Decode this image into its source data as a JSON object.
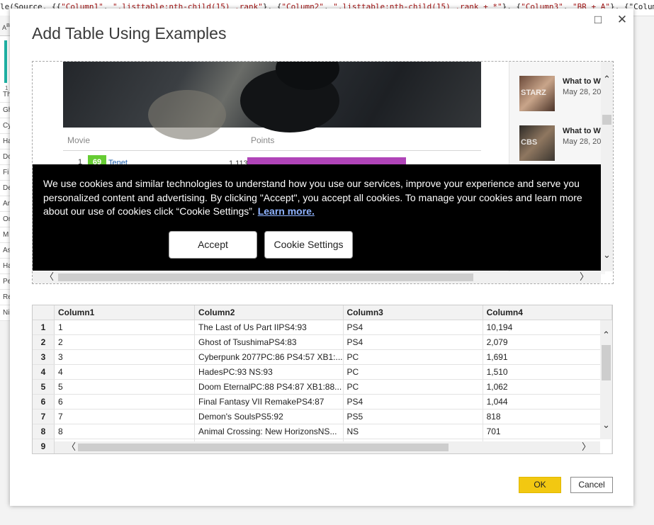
{
  "formula_bar": {
    "text": "le(Source, {{\"Column1\", \".listtable:nth-child(15) .rank\"}, {\"Column2\", \".listtable:nth-child(15) .rank + *\"}, {\"Column3\", \"BR + A\"}, {\"Colum"
  },
  "left_strip": {
    "header": "A",
    "header_sup": "B",
    "label": "1",
    "cells": [
      "Th",
      "Gh",
      "Cy",
      "Ha",
      "Do",
      "Fi",
      "De",
      "An",
      "Or",
      "M",
      "As",
      "Ha",
      "Pe",
      "Re",
      "Ni"
    ]
  },
  "dialog": {
    "title": "Add Table Using Examples",
    "restore_icon": "□",
    "close_icon": "✕",
    "ok_label": "OK",
    "cancel_label": "Cancel"
  },
  "preview": {
    "movie_chart": {
      "col_movie": "Movie",
      "col_points": "Points",
      "row": {
        "rank": "1",
        "score": "69",
        "name": "Tenet",
        "points": "1,113"
      }
    },
    "sidebar": [
      {
        "heading": "What to W",
        "date": "May 28, 20",
        "tag": "STARZ"
      },
      {
        "heading": "What to W",
        "date": "May 28, 20",
        "tag": "CBS"
      }
    ],
    "cookie": {
      "text": "We use cookies and similar technologies to understand how you use our services, improve your experience and serve you personalized content and advertising. By clicking \"Accept\", you accept all cookies. To manage your cookies and learn more about our use of cookies click “Cookie Settings”.",
      "link": "Learn more.",
      "accept": "Accept",
      "settings": "Cookie Settings"
    }
  },
  "table": {
    "columns": [
      "Column1",
      "Column2",
      "Column3",
      "Column4"
    ],
    "rows": [
      [
        "1",
        "1",
        "The Last of Us Part IIPS4:93",
        "PS4",
        "10,194"
      ],
      [
        "2",
        "2",
        "Ghost of TsushimaPS4:83",
        "PS4",
        "2,079"
      ],
      [
        "3",
        "3",
        "Cyberpunk 2077PC:86 PS4:57 XB1:...",
        "PC",
        "1,691"
      ],
      [
        "4",
        "4",
        "HadesPC:93 NS:93",
        "PC",
        "1,510"
      ],
      [
        "5",
        "5",
        "Doom EternalPC:88 PS4:87 XB1:88...",
        "PC",
        "1,062"
      ],
      [
        "6",
        "6",
        "Final Fantasy VII RemakePS4:87",
        "PS4",
        "1,044"
      ],
      [
        "7",
        "7",
        "Demon's SoulsPS5:92",
        "PS5",
        "818"
      ],
      [
        "8",
        "8",
        "Animal Crossing: New HorizonsNS...",
        "NS",
        "701"
      ],
      [
        "9",
        "",
        "",
        "",
        ""
      ]
    ]
  }
}
